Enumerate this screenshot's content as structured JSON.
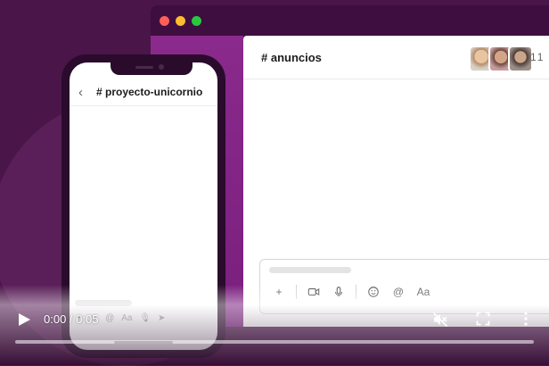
{
  "desktop": {
    "channel_title": "# anuncios",
    "member_count": "11",
    "avatars": [
      "avatar-1",
      "avatar-2",
      "avatar-3"
    ],
    "composer_tools": {
      "plus": "+",
      "format": "Aa"
    }
  },
  "phone": {
    "back": "‹",
    "channel_title": "# proyecto-unicornio",
    "composer_tools": [
      "+",
      "☺",
      "@",
      "Aa",
      "🎙",
      "➤"
    ]
  },
  "video": {
    "time": "0:00 / 0:05",
    "muted": true
  },
  "colors": {
    "background": "#4a1548",
    "sidebar": "#8a2a8c",
    "window_chrome": "#3f0e40"
  }
}
